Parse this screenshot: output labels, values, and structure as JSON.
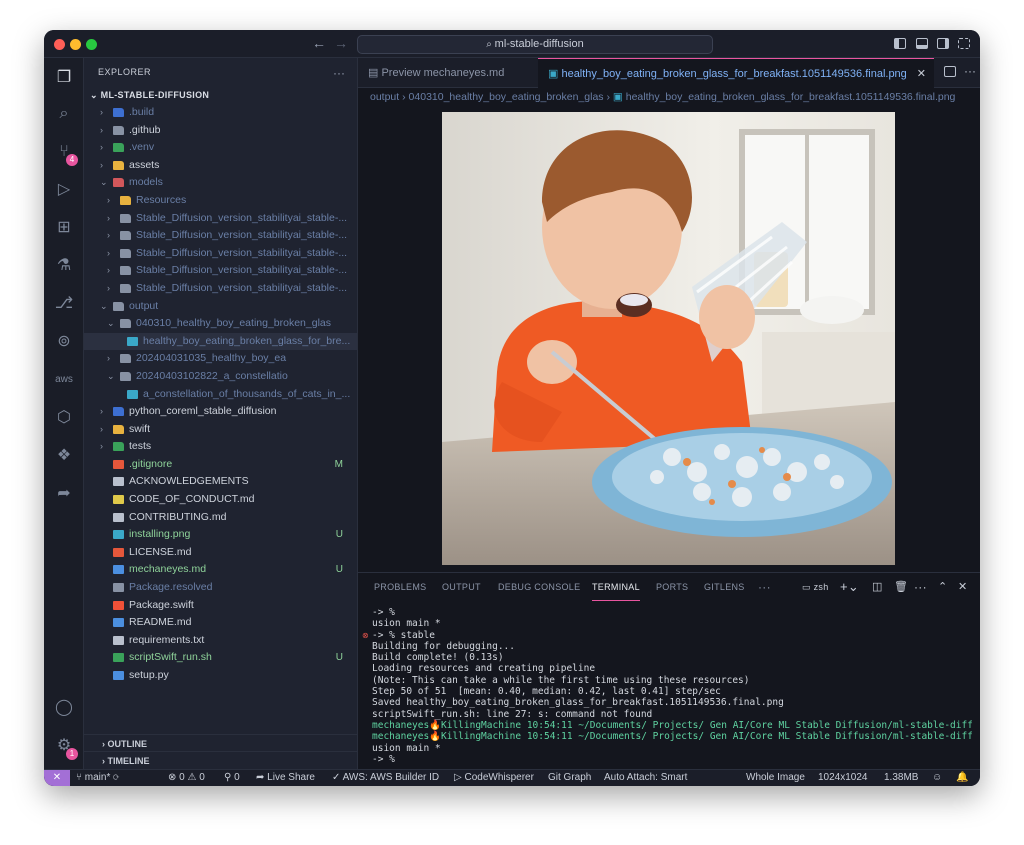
{
  "window": {
    "title": "ml-stable-diffusion"
  },
  "explorer": {
    "header": "EXPLORER",
    "more": "···",
    "project": "ML-STABLE-DIFFUSION",
    "tree": [
      {
        "label": ".build",
        "depth": 0,
        "kind": "folder",
        "open": false,
        "color": "#6a7fa6",
        "icon": "#3d6fd1"
      },
      {
        "label": ".github",
        "depth": 0,
        "kind": "folder",
        "open": false,
        "color": "#cdd2db",
        "icon": "#8892a4"
      },
      {
        "label": ".venv",
        "depth": 0,
        "kind": "folder",
        "open": false,
        "color": "#6a7fa6",
        "icon": "#3aa25a"
      },
      {
        "label": "assets",
        "depth": 0,
        "kind": "folder",
        "open": false,
        "color": "#cdd2db",
        "icon": "#e8b23f"
      },
      {
        "label": "models",
        "depth": 0,
        "kind": "folder",
        "open": true,
        "color": "#6a7fa6",
        "icon": "#d2575b"
      },
      {
        "label": "Resources",
        "depth": 1,
        "kind": "folder",
        "open": false,
        "color": "#6a7fa6",
        "icon": "#e8b23f"
      },
      {
        "label": "Stable_Diffusion_version_stabilityai_stable-...",
        "depth": 1,
        "kind": "folder",
        "open": false,
        "color": "#6a7fa6",
        "icon": "#8892a4"
      },
      {
        "label": "Stable_Diffusion_version_stabilityai_stable-...",
        "depth": 1,
        "kind": "folder",
        "open": false,
        "color": "#6a7fa6",
        "icon": "#8892a4"
      },
      {
        "label": "Stable_Diffusion_version_stabilityai_stable-...",
        "depth": 1,
        "kind": "folder",
        "open": false,
        "color": "#6a7fa6",
        "icon": "#8892a4"
      },
      {
        "label": "Stable_Diffusion_version_stabilityai_stable-...",
        "depth": 1,
        "kind": "folder",
        "open": false,
        "color": "#6a7fa6",
        "icon": "#8892a4"
      },
      {
        "label": "Stable_Diffusion_version_stabilityai_stable-...",
        "depth": 1,
        "kind": "folder",
        "open": false,
        "color": "#6a7fa6",
        "icon": "#8892a4"
      },
      {
        "label": "output",
        "depth": 0,
        "kind": "folder",
        "open": true,
        "color": "#6a7fa6",
        "icon": "#8892a4"
      },
      {
        "label": "040310_healthy_boy_eating_broken_glas",
        "depth": 1,
        "kind": "folder",
        "open": true,
        "color": "#6a7fa6",
        "icon": "#8892a4"
      },
      {
        "label": "healthy_boy_eating_broken_glass_for_bre...",
        "depth": 2,
        "kind": "file",
        "color": "#6a7fa6",
        "icon": "#3aa8c8",
        "selected": true
      },
      {
        "label": "202404031035_healthy_boy_ea",
        "depth": 1,
        "kind": "folder",
        "open": false,
        "color": "#6a7fa6",
        "icon": "#8892a4"
      },
      {
        "label": "20240403102822_a_constellatio",
        "depth": 1,
        "kind": "folder",
        "open": true,
        "color": "#6a7fa6",
        "icon": "#8892a4"
      },
      {
        "label": "a_constellation_of_thousands_of_cats_in_...",
        "depth": 2,
        "kind": "file",
        "color": "#6a7fa6",
        "icon": "#3aa8c8"
      },
      {
        "label": "python_coreml_stable_diffusion",
        "depth": 0,
        "kind": "folder",
        "open": false,
        "color": "#cdd2db",
        "icon": "#3d6fd1"
      },
      {
        "label": "swift",
        "depth": 0,
        "kind": "folder",
        "open": false,
        "color": "#cdd2db",
        "icon": "#e8b23f"
      },
      {
        "label": "tests",
        "depth": 0,
        "kind": "folder",
        "open": false,
        "color": "#cdd2db",
        "icon": "#3aa25a"
      },
      {
        "label": ".gitignore",
        "depth": 0,
        "kind": "file",
        "color": "#8fd39a",
        "icon": "#e5573b",
        "status": "M",
        "statusColor": "#8fd39a"
      },
      {
        "label": "ACKNOWLEDGEMENTS",
        "depth": 0,
        "kind": "file",
        "color": "#cdd2db",
        "icon": "#b9c0cd"
      },
      {
        "label": "CODE_OF_CONDUCT.md",
        "depth": 0,
        "kind": "file",
        "color": "#cdd2db",
        "icon": "#e0c94a"
      },
      {
        "label": "CONTRIBUTING.md",
        "depth": 0,
        "kind": "file",
        "color": "#cdd2db",
        "icon": "#b9c0cd"
      },
      {
        "label": "installing.png",
        "depth": 0,
        "kind": "file",
        "color": "#8fd39a",
        "icon": "#3aa8c8",
        "status": "U",
        "statusColor": "#8fd39a"
      },
      {
        "label": "LICENSE.md",
        "depth": 0,
        "kind": "file",
        "color": "#cdd2db",
        "icon": "#e5573b"
      },
      {
        "label": "mechaneyes.md",
        "depth": 0,
        "kind": "file",
        "color": "#8fd39a",
        "icon": "#4b8fe0",
        "status": "U",
        "statusColor": "#8fd39a"
      },
      {
        "label": "Package.resolved",
        "depth": 0,
        "kind": "file",
        "color": "#6a7fa6",
        "icon": "#8892a4"
      },
      {
        "label": "Package.swift",
        "depth": 0,
        "kind": "file",
        "color": "#cdd2db",
        "icon": "#f05138"
      },
      {
        "label": "README.md",
        "depth": 0,
        "kind": "file",
        "color": "#cdd2db",
        "icon": "#4b8fe0"
      },
      {
        "label": "requirements.txt",
        "depth": 0,
        "kind": "file",
        "color": "#cdd2db",
        "icon": "#b9c0cd"
      },
      {
        "label": "scriptSwift_run.sh",
        "depth": 0,
        "kind": "file",
        "color": "#8fd39a",
        "icon": "#3aa25a",
        "status": "U",
        "statusColor": "#8fd39a"
      },
      {
        "label": "setup.py",
        "depth": 0,
        "kind": "file",
        "color": "#cdd2db",
        "icon": "#4b8fe0"
      }
    ],
    "outline": "OUTLINE",
    "timeline": "TIMELINE"
  },
  "activity": {
    "source_control_badge": "4",
    "accounts_badge": "1"
  },
  "editor": {
    "tabs": [
      {
        "label": "Preview mechaneyes.md",
        "active": false
      },
      {
        "label": "healthy_boy_eating_broken_glass_for_breakfast.1051149536.final.png",
        "active": true
      }
    ],
    "breadcrumbs": [
      "output",
      "040310_healthy_boy_eating_broken_glas",
      "healthy_boy_eating_broken_glass_for_breakfast.1051149536.final.png"
    ]
  },
  "panel": {
    "tabs": [
      "PROBLEMS",
      "OUTPUT",
      "DEBUG CONSOLE",
      "TERMINAL",
      "PORTS",
      "GITLENS"
    ],
    "active_tab": "TERMINAL",
    "more": "···",
    "shell": "zsh",
    "terminal_lines": [
      "-> %",
      "usion main *",
      "-> % stable",
      "Building for debugging...",
      "Build complete! (0.13s)",
      "Loading resources and creating pipeline",
      "(Note: This can take a while the first time using these resources)",
      "Step 50 of 51  [mean: 0.40, median: 0.42, last 0.41] step/sec",
      "Saved healthy_boy_eating_broken_glass_for_breakfast.1051149536.final.png",
      "scriptSwift_run.sh: line 27: s: command not found",
      "mechaneyes🔥KillingMachine 10:54:11 ~/Documents/ Projects/ Gen AI/Core ML Stable Diffusion/ml-stable-diff",
      "mechaneyes🔥KillingMachine 10:54:11 ~/Documents/ Projects/ Gen AI/Core ML Stable Diffusion/ml-stable-diff",
      "usion main *",
      "-> % "
    ]
  },
  "status": {
    "remote": "✕",
    "branch": "main*",
    "errors": "0",
    "warnings": "0",
    "ports": "0",
    "live_share": "Live Share",
    "aws": "AWS: AWS Builder ID",
    "codewhisperer": "CodeWhisperer",
    "git_graph": "Git Graph",
    "auto_attach": "Auto Attach: Smart",
    "whole_image": "Whole Image",
    "dimensions": "1024x1024",
    "file_size": "1.38MB"
  }
}
